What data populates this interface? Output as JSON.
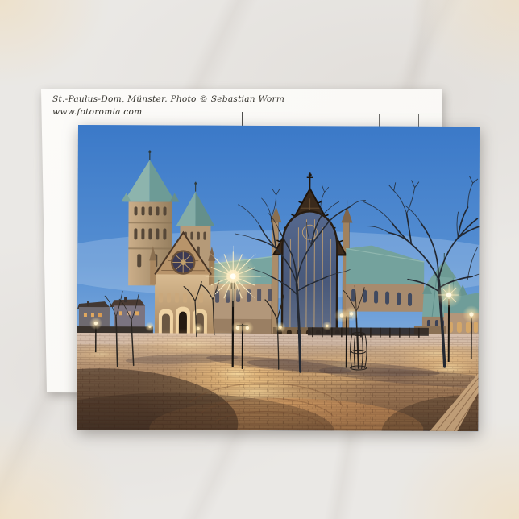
{
  "product": {
    "kind": "postcard-mockup",
    "caption_line1": "St.-Paulus-Dom, Münster. Photo © Sebastian Worm",
    "caption_line2": "www.fotoromia.com"
  },
  "photo": {
    "subject": "St.-Paulus-Dom cathedral and cobblestone square at blue hour with glowing street lamps and bare trees, Münster"
  },
  "colors": {
    "marble_base": "#eae8e5",
    "corner_tint": "#f0dbb6",
    "card_white": "#fbfaf7",
    "caption_text": "#35332d",
    "mark_gray": "#6d6d6b",
    "sky_top": "#3b79c8",
    "sky_horizon": "#a3c2e4",
    "roof_teal": "#78a5a0",
    "stone_lit": "#d9bc92",
    "plaza_warm": "#c29b73",
    "lamp_glow": "#ffeec2"
  }
}
